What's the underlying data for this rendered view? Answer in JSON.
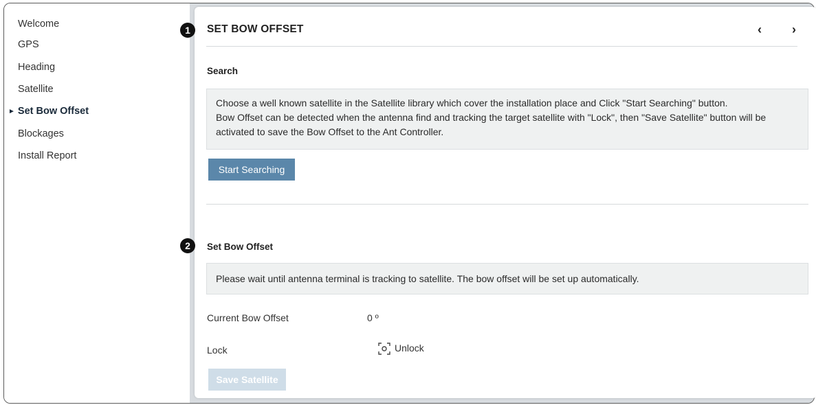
{
  "sidebar": {
    "items": [
      {
        "label": "Welcome",
        "active": false
      },
      {
        "label": "GPS",
        "active": false
      },
      {
        "label": "Heading",
        "active": false
      },
      {
        "label": "Satellite",
        "active": false
      },
      {
        "label": "Set Bow Offset",
        "active": true
      },
      {
        "label": "Blockages",
        "active": false
      },
      {
        "label": "Install Report",
        "active": false
      }
    ],
    "active_marker": "►"
  },
  "header": {
    "step_badge": "1",
    "title": "SET BOW OFFSET",
    "prev_icon": "chevron-left-icon",
    "next_icon": "chevron-right-icon",
    "prev_glyph": "‹",
    "next_glyph": "›"
  },
  "search": {
    "heading": "Search",
    "info_lines": [
      "Choose a well known satellite in the Satellite library which cover the installation place and Click \"Start Searching\" button.",
      "Bow Offset can be detected when the antenna find and tracking the target satellite with \"Lock\", then \"Save Satellite\" button will be activated to save the Bow Offset to the Ant Controller."
    ],
    "button_label": "Start Searching"
  },
  "bow_offset": {
    "step_badge": "2",
    "heading": "Set Bow Offset",
    "info": "Please wait until antenna terminal is tracking to satellite. The bow offset will be set up automatically.",
    "current_label": "Current Bow Offset",
    "current_value": "0 º",
    "lock_label": "Lock",
    "lock_icon": "focus-target-icon",
    "lock_value": "Unlock",
    "save_button_label": "Save Satellite",
    "save_enabled": false
  },
  "colors": {
    "primary_button": "#5b87aa",
    "disabled_button": "#cfdde8",
    "gutter": "#d7dbdf",
    "info_box": "#eff1f1"
  }
}
